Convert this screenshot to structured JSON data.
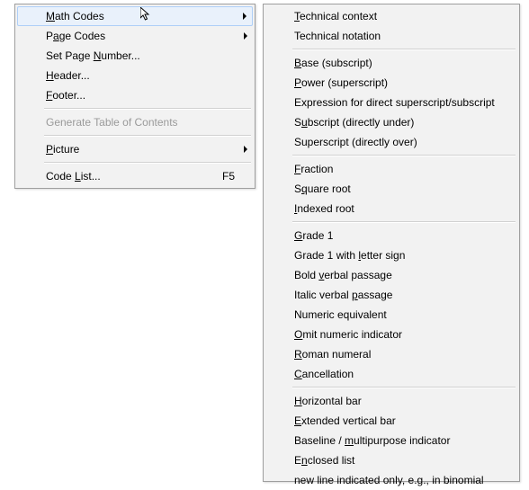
{
  "left_menu": {
    "groups": [
      [
        {
          "id": "math-codes",
          "pre": "",
          "u": "M",
          "post": "ath Codes",
          "arrow": true,
          "highlight": true
        },
        {
          "id": "page-codes",
          "pre": "P",
          "u": "a",
          "post": "ge Codes",
          "arrow": true
        },
        {
          "id": "set-page-number",
          "pre": "Set Page ",
          "u": "N",
          "post": "umber..."
        },
        {
          "id": "header",
          "pre": "",
          "u": "H",
          "post": "eader..."
        },
        {
          "id": "footer",
          "pre": "",
          "u": "F",
          "post": "ooter..."
        }
      ],
      [
        {
          "id": "generate-toc",
          "pre": "Generate Table of Contents",
          "u": "",
          "post": "",
          "disabled": true
        }
      ],
      [
        {
          "id": "picture",
          "pre": "",
          "u": "P",
          "post": "icture",
          "arrow": true
        }
      ],
      [
        {
          "id": "code-list",
          "pre": "Code ",
          "u": "L",
          "post": "ist...",
          "accel": "F5"
        }
      ]
    ]
  },
  "right_menu": {
    "groups": [
      [
        {
          "id": "technical-context",
          "pre": "",
          "u": "T",
          "post": "echnical context"
        },
        {
          "id": "technical-notation",
          "pre": "Technical notation",
          "u": "",
          "post": ""
        }
      ],
      [
        {
          "id": "base-subscript",
          "pre": "",
          "u": "B",
          "post": "ase (subscript)"
        },
        {
          "id": "power-superscript",
          "pre": "",
          "u": "P",
          "post": "ower (superscript)"
        },
        {
          "id": "expression-direct",
          "pre": "Expression for direct superscript/subscript",
          "u": "",
          "post": ""
        },
        {
          "id": "subscript-under",
          "pre": "S",
          "u": "u",
          "post": "bscript (directly under)"
        },
        {
          "id": "superscript-over",
          "pre": "Superscript (directly over)",
          "u": "",
          "post": ""
        }
      ],
      [
        {
          "id": "fraction",
          "pre": "",
          "u": "F",
          "post": "raction"
        },
        {
          "id": "square-root",
          "pre": "S",
          "u": "q",
          "post": "uare root"
        },
        {
          "id": "indexed-root",
          "pre": "",
          "u": "I",
          "post": "ndexed root"
        }
      ],
      [
        {
          "id": "grade1",
          "pre": "",
          "u": "G",
          "post": "rade 1"
        },
        {
          "id": "grade1-letter",
          "pre": "Grade 1 with ",
          "u": "l",
          "post": "etter sign"
        },
        {
          "id": "bold-verbal",
          "pre": "Bold ",
          "u": "v",
          "post": "erbal passage"
        },
        {
          "id": "italic-verbal",
          "pre": "Italic verbal ",
          "u": "p",
          "post": "assage"
        },
        {
          "id": "numeric-equiv",
          "pre": "Numeric equivalent",
          "u": "",
          "post": ""
        },
        {
          "id": "omit-numeric",
          "pre": "",
          "u": "O",
          "post": "mit numeric indicator"
        },
        {
          "id": "roman-numeral",
          "pre": "",
          "u": "R",
          "post": "oman numeral"
        },
        {
          "id": "cancellation",
          "pre": "",
          "u": "C",
          "post": "ancellation"
        }
      ],
      [
        {
          "id": "horizontal-bar",
          "pre": "",
          "u": "H",
          "post": "orizontal bar"
        },
        {
          "id": "extended-vbar",
          "pre": "",
          "u": "E",
          "post": "xtended vertical bar"
        },
        {
          "id": "baseline-multi",
          "pre": "Baseline / ",
          "u": "m",
          "post": "ultipurpose indicator"
        },
        {
          "id": "enclosed-list",
          "pre": "E",
          "u": "n",
          "post": "closed list"
        },
        {
          "id": "new-line-binom",
          "pre": "new line indicated only, e.g., in binomial",
          "u": "",
          "post": ""
        }
      ]
    ]
  }
}
